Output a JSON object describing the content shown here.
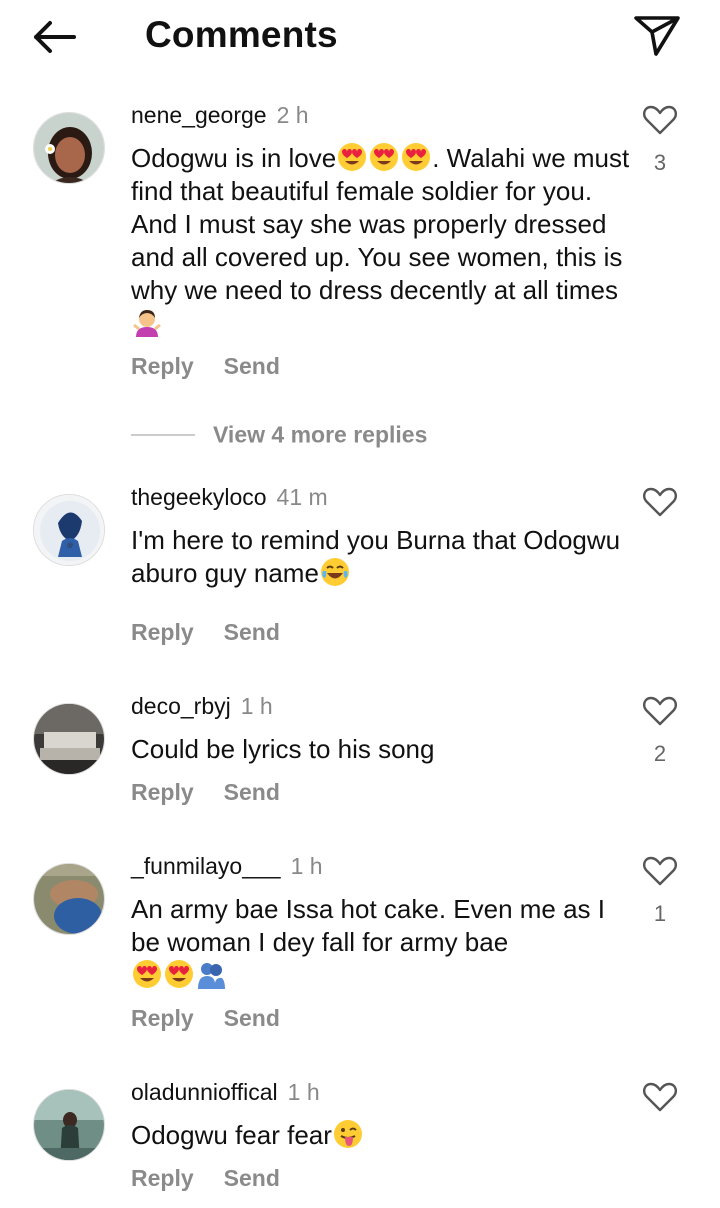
{
  "header": {
    "title": "Comments"
  },
  "view_more_replies": "View 4 more replies",
  "actions": {
    "reply": "Reply",
    "send": "Send"
  },
  "comments": [
    {
      "username": "nene_george",
      "time": "2 h",
      "text_parts": [
        "Odogwu is in love",
        ". Walahi we must find that beautiful female soldier for you. And I must say she was properly dressed and all covered up. You see women, this is why we need to dress decently at all times "
      ],
      "likes": "3"
    },
    {
      "username": "thegeekyloco",
      "time": "41 m",
      "text": "I'm here to remind you Burna that Odogwu aburo guy name",
      "likes": ""
    },
    {
      "username": "deco_rbyj",
      "time": "1 h",
      "text": "Could be lyrics to his song",
      "likes": "2"
    },
    {
      "username": "_funmilayo___",
      "time": "1 h",
      "text": "An army bae Issa hot cake.  Even me as I be woman I dey fall for army bae",
      "likes": "1"
    },
    {
      "username": "oladunnioffical",
      "time": "1 h",
      "text": "Odogwu fear fear",
      "likes": ""
    }
  ]
}
